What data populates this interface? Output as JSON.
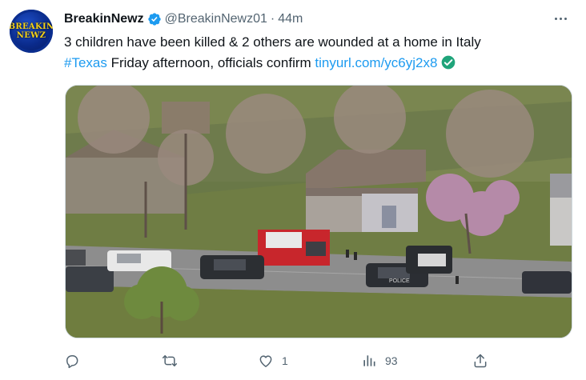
{
  "author": {
    "avatar_text_line1": "BREAKIN",
    "avatar_text_line2": "NEWZ",
    "display_name": "BreakinNewz",
    "handle": "@BreakinNewz01",
    "separator": "·",
    "time": "44m"
  },
  "tweet": {
    "text_part1": "3 children have been killed & 2 others are wounded at a home in Italy",
    "hashtag": "#Texas",
    "text_part2": " Friday afternoon, officials confirm ",
    "link": "tinyurl.com/yc6yj2x8"
  },
  "media": {
    "vehicle_text": "POLICE"
  },
  "actions": {
    "replies": "",
    "retweets": "",
    "likes": "1",
    "views": "93"
  },
  "colors": {
    "accent": "#1d9bf0",
    "verified_green": "#00ba7c",
    "muted": "#536471"
  }
}
